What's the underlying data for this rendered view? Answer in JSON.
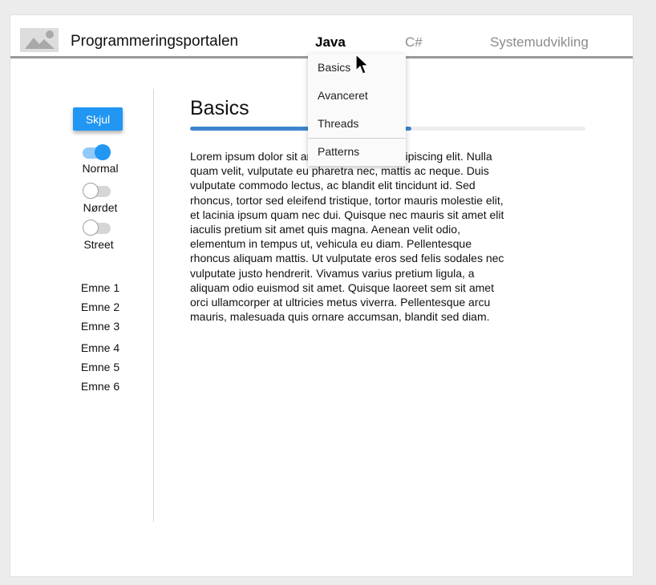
{
  "header": {
    "app_title": "Programmeringsportalen",
    "nav": [
      "Java",
      "C#",
      "Systemudvikling"
    ],
    "active_nav": "Java"
  },
  "dropdown": {
    "items": [
      "Basics",
      "Avanceret",
      "Threads",
      "Patterns"
    ]
  },
  "sidebar": {
    "hide_button": "Skjul",
    "toggles": [
      {
        "label": "Normal",
        "on": true
      },
      {
        "label": "Nørdet",
        "on": false
      },
      {
        "label": "Street",
        "on": false
      }
    ],
    "topics": [
      "Emne 1",
      "Emne 2",
      "Emne 3",
      "Emne 4",
      "Emne 5",
      "Emne 6"
    ]
  },
  "content": {
    "title": "Basics",
    "progress": 0.56,
    "text": "Lorem ipsum dolor sit amet, consectetur adipiscing elit. Nulla quam velit, vulputate eu pharetra nec, mattis ac neque. Duis vulputate commodo lectus, ac blandit elit tincidunt id. Sed rhoncus, tortor sed eleifend tristique, tortor mauris molestie elit, et lacinia ipsum quam nec dui. Quisque nec mauris sit amet elit iaculis pretium sit amet quis magna. Aenean velit odio, elementum in tempus ut, vehicula eu diam. Pellentesque rhoncus aliquam mattis. Ut vulputate eros sed felis sodales nec vulputate justo hendrerit. Vivamus varius pretium ligula, a aliquam odio euismod sit amet. Quisque laoreet sem sit amet orci ullamcorper at ultricies metus viverra. Pellentesque arcu mauris, malesuada quis ornare accumsan, blandit sed diam."
  },
  "colors": {
    "accent": "#2196f3",
    "progress": "#3d86cf"
  },
  "icons": {
    "logo": "image-placeholder-icon",
    "cursor": "mouse-pointer-icon"
  }
}
